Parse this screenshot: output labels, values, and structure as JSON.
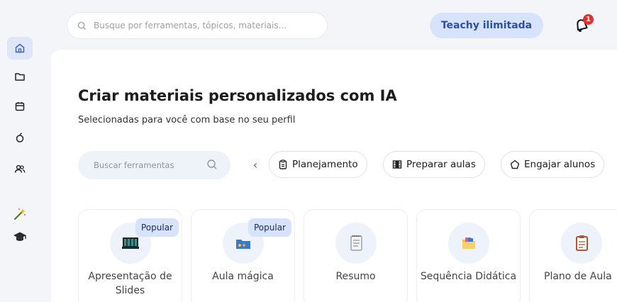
{
  "search": {
    "placeholder": "Busque por ferramentas, tópicos, materiais..."
  },
  "header": {
    "promo_label": "Teachy ilimitada",
    "notification_count": "1"
  },
  "sidebar": {
    "items": [
      "home-icon",
      "folder-icon",
      "calendar-icon",
      "apple-icon",
      "users-icon",
      "magic-wand-icon",
      "graduation-cap-icon"
    ]
  },
  "main": {
    "title": "Criar materiais personalizados com IA",
    "subtitle": "Selecionadas para você com base no seu perfil",
    "tool_search_placeholder": "Buscar ferramentas",
    "chips": [
      {
        "label": "Planejamento",
        "icon": "clipboard-icon"
      },
      {
        "label": "Preparar aulas",
        "icon": "film-icon"
      },
      {
        "label": "Engajar alunos",
        "icon": "shape-icon"
      }
    ],
    "cards": [
      {
        "label": "Apresentação de Slides",
        "badge": "Popular",
        "icon": "slides-icon"
      },
      {
        "label": "Aula mágica",
        "badge": "Popular",
        "icon": "magic-folder-icon"
      },
      {
        "label": "Resumo",
        "badge": "",
        "icon": "notepad-icon"
      },
      {
        "label": "Sequência Didática",
        "badge": "",
        "icon": "folder-sequence-icon"
      },
      {
        "label": "Plano de Aula",
        "badge": "",
        "icon": "lesson-plan-icon"
      }
    ]
  },
  "colors": {
    "accent": "#3b63c8",
    "promo_bg": "#d7e2fb",
    "badge_red": "#e03131"
  }
}
